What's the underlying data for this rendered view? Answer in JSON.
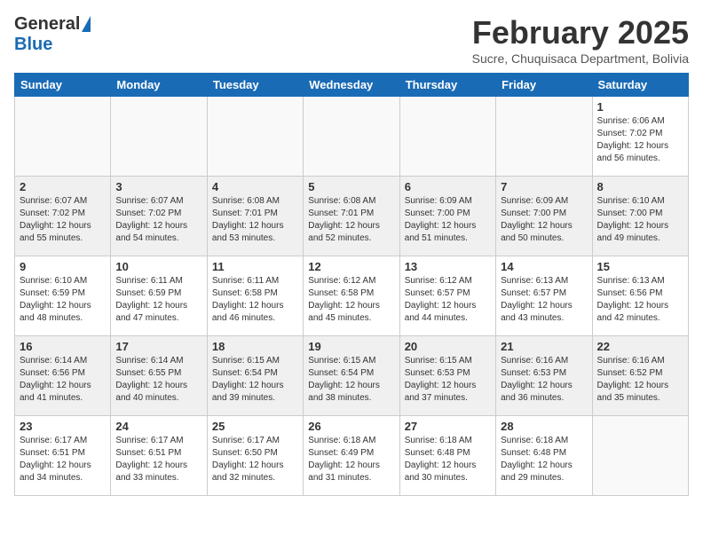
{
  "header": {
    "logo_general": "General",
    "logo_blue": "Blue",
    "month_year": "February 2025",
    "location": "Sucre, Chuquisaca Department, Bolivia"
  },
  "weekdays": [
    "Sunday",
    "Monday",
    "Tuesday",
    "Wednesday",
    "Thursday",
    "Friday",
    "Saturday"
  ],
  "weeks": [
    [
      {
        "day": "",
        "info": ""
      },
      {
        "day": "",
        "info": ""
      },
      {
        "day": "",
        "info": ""
      },
      {
        "day": "",
        "info": ""
      },
      {
        "day": "",
        "info": ""
      },
      {
        "day": "",
        "info": ""
      },
      {
        "day": "1",
        "info": "Sunrise: 6:06 AM\nSunset: 7:02 PM\nDaylight: 12 hours\nand 56 minutes."
      }
    ],
    [
      {
        "day": "2",
        "info": "Sunrise: 6:07 AM\nSunset: 7:02 PM\nDaylight: 12 hours\nand 55 minutes."
      },
      {
        "day": "3",
        "info": "Sunrise: 6:07 AM\nSunset: 7:02 PM\nDaylight: 12 hours\nand 54 minutes."
      },
      {
        "day": "4",
        "info": "Sunrise: 6:08 AM\nSunset: 7:01 PM\nDaylight: 12 hours\nand 53 minutes."
      },
      {
        "day": "5",
        "info": "Sunrise: 6:08 AM\nSunset: 7:01 PM\nDaylight: 12 hours\nand 52 minutes."
      },
      {
        "day": "6",
        "info": "Sunrise: 6:09 AM\nSunset: 7:00 PM\nDaylight: 12 hours\nand 51 minutes."
      },
      {
        "day": "7",
        "info": "Sunrise: 6:09 AM\nSunset: 7:00 PM\nDaylight: 12 hours\nand 50 minutes."
      },
      {
        "day": "8",
        "info": "Sunrise: 6:10 AM\nSunset: 7:00 PM\nDaylight: 12 hours\nand 49 minutes."
      }
    ],
    [
      {
        "day": "9",
        "info": "Sunrise: 6:10 AM\nSunset: 6:59 PM\nDaylight: 12 hours\nand 48 minutes."
      },
      {
        "day": "10",
        "info": "Sunrise: 6:11 AM\nSunset: 6:59 PM\nDaylight: 12 hours\nand 47 minutes."
      },
      {
        "day": "11",
        "info": "Sunrise: 6:11 AM\nSunset: 6:58 PM\nDaylight: 12 hours\nand 46 minutes."
      },
      {
        "day": "12",
        "info": "Sunrise: 6:12 AM\nSunset: 6:58 PM\nDaylight: 12 hours\nand 45 minutes."
      },
      {
        "day": "13",
        "info": "Sunrise: 6:12 AM\nSunset: 6:57 PM\nDaylight: 12 hours\nand 44 minutes."
      },
      {
        "day": "14",
        "info": "Sunrise: 6:13 AM\nSunset: 6:57 PM\nDaylight: 12 hours\nand 43 minutes."
      },
      {
        "day": "15",
        "info": "Sunrise: 6:13 AM\nSunset: 6:56 PM\nDaylight: 12 hours\nand 42 minutes."
      }
    ],
    [
      {
        "day": "16",
        "info": "Sunrise: 6:14 AM\nSunset: 6:56 PM\nDaylight: 12 hours\nand 41 minutes."
      },
      {
        "day": "17",
        "info": "Sunrise: 6:14 AM\nSunset: 6:55 PM\nDaylight: 12 hours\nand 40 minutes."
      },
      {
        "day": "18",
        "info": "Sunrise: 6:15 AM\nSunset: 6:54 PM\nDaylight: 12 hours\nand 39 minutes."
      },
      {
        "day": "19",
        "info": "Sunrise: 6:15 AM\nSunset: 6:54 PM\nDaylight: 12 hours\nand 38 minutes."
      },
      {
        "day": "20",
        "info": "Sunrise: 6:15 AM\nSunset: 6:53 PM\nDaylight: 12 hours\nand 37 minutes."
      },
      {
        "day": "21",
        "info": "Sunrise: 6:16 AM\nSunset: 6:53 PM\nDaylight: 12 hours\nand 36 minutes."
      },
      {
        "day": "22",
        "info": "Sunrise: 6:16 AM\nSunset: 6:52 PM\nDaylight: 12 hours\nand 35 minutes."
      }
    ],
    [
      {
        "day": "23",
        "info": "Sunrise: 6:17 AM\nSunset: 6:51 PM\nDaylight: 12 hours\nand 34 minutes."
      },
      {
        "day": "24",
        "info": "Sunrise: 6:17 AM\nSunset: 6:51 PM\nDaylight: 12 hours\nand 33 minutes."
      },
      {
        "day": "25",
        "info": "Sunrise: 6:17 AM\nSunset: 6:50 PM\nDaylight: 12 hours\nand 32 minutes."
      },
      {
        "day": "26",
        "info": "Sunrise: 6:18 AM\nSunset: 6:49 PM\nDaylight: 12 hours\nand 31 minutes."
      },
      {
        "day": "27",
        "info": "Sunrise: 6:18 AM\nSunset: 6:48 PM\nDaylight: 12 hours\nand 30 minutes."
      },
      {
        "day": "28",
        "info": "Sunrise: 6:18 AM\nSunset: 6:48 PM\nDaylight: 12 hours\nand 29 minutes."
      },
      {
        "day": "",
        "info": ""
      }
    ]
  ]
}
